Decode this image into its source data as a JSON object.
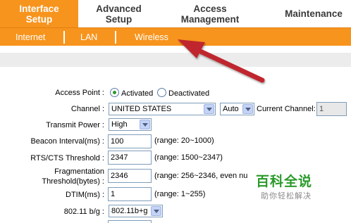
{
  "nav": {
    "tabs": [
      {
        "label": "Interface\nSetup",
        "line1": "Interface",
        "line2": "Setup"
      },
      {
        "line1": "Advanced",
        "line2": "Setup"
      },
      {
        "line1": "Access",
        "line2": "Management"
      },
      {
        "line1": "Maintenance"
      }
    ],
    "subtabs": [
      "Internet",
      "LAN",
      "Wireless"
    ]
  },
  "colors": {
    "accent": "#f7941d",
    "arrow": "#c0282d",
    "radio_on": "#2a9a2a",
    "watermark": "#2a9a2a"
  },
  "form": {
    "access_point": {
      "label": "Access Point :",
      "options": [
        "Activated",
        "Deactivated"
      ],
      "selected": "Activated"
    },
    "channel": {
      "label": "Channel :",
      "country": "UNITED STATES",
      "mode": "Auto",
      "current_label": "Current Channel:",
      "current_value": "1"
    },
    "transmit_power": {
      "label": "Transmit Power :",
      "value": "High"
    },
    "beacon_interval": {
      "label": "Beacon Interval(ms) :",
      "value": "100",
      "range": "(range: 20~1000)"
    },
    "rts_threshold": {
      "label": "RTS/CTS Threshold :",
      "value": "2347",
      "range": "(range: 1500~2347)"
    },
    "fragmentation": {
      "label_line1": "Fragmentation",
      "label_line2": "Threshold(bytes) :",
      "value": "2346",
      "range": "(range: 256~2346, even nu"
    },
    "dtim": {
      "label": "DTIM(ms) :",
      "value": "1",
      "range": "(range: 1~255)"
    },
    "mode_80211": {
      "label": "802.11 b/g :",
      "value": "802.11b+g"
    }
  },
  "watermark": {
    "title": "百科全说",
    "subtitle": "助你轻松解决"
  },
  "icons": {
    "pointer": "arrow-pointer-icon"
  }
}
